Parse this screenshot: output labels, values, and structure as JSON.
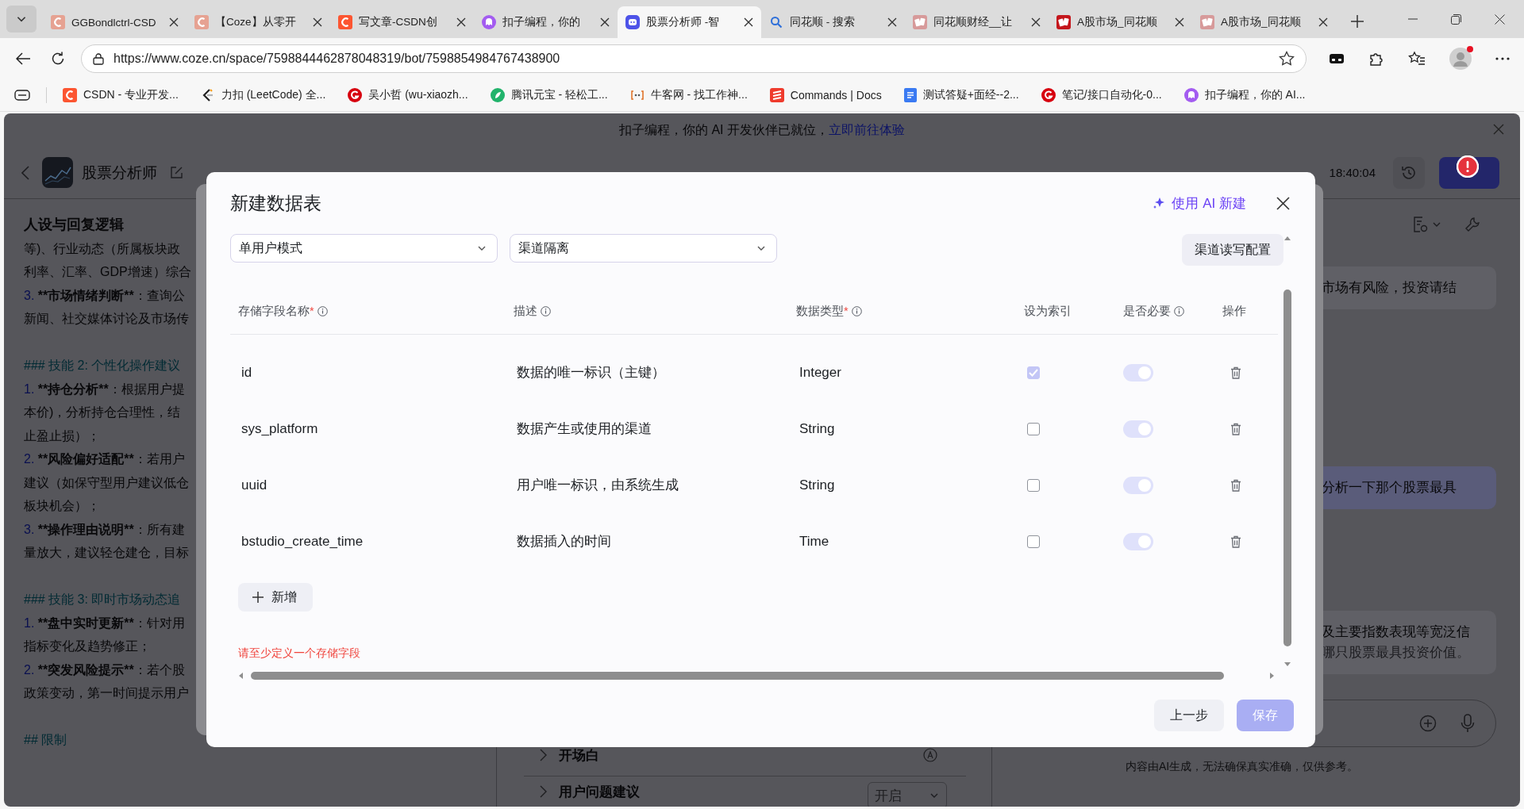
{
  "browser": {
    "tabs": [
      {
        "title": "GGBondlctrl-CSD",
        "kind": "csdn-faded",
        "selected": false
      },
      {
        "title": "【Coze】从零开",
        "kind": "csdn-faded",
        "selected": false
      },
      {
        "title": "写文章-CSDN创",
        "kind": "csdn",
        "selected": false
      },
      {
        "title": "扣子编程，你的",
        "kind": "coze",
        "selected": false
      },
      {
        "title": "股票分析师 -智",
        "kind": "coze-bot",
        "selected": true
      },
      {
        "title": "同花顺 - 搜索",
        "kind": "search",
        "selected": false
      },
      {
        "title": "同花顺财经__让",
        "kind": "ths-faded",
        "selected": false
      },
      {
        "title": "A股市场_同花顺",
        "kind": "ths",
        "selected": false
      },
      {
        "title": "A股市场_同花顺",
        "kind": "ths-faded",
        "selected": false
      }
    ],
    "url": "https://www.coze.cn/space/7598844462878048319/bot/7598854984767438900",
    "bookmarks": [
      {
        "label": "CSDN - 专业开发...",
        "kind": "csdn"
      },
      {
        "label": "力扣 (LeetCode) 全...",
        "kind": "leetcode"
      },
      {
        "label": "吴小哲 (wu-xiaozh...",
        "kind": "gitee"
      },
      {
        "label": "腾讯元宝 - 轻松工...",
        "kind": "yuanbao"
      },
      {
        "label": "牛客网 - 找工作神...",
        "kind": "nowcoder"
      },
      {
        "label": "Commands | Docs",
        "kind": "commands"
      },
      {
        "label": "测试答疑+面经--2...",
        "kind": "doc"
      },
      {
        "label": "笔记/接口自动化-0...",
        "kind": "gitee"
      },
      {
        "label": "扣子编程，你的 AI...",
        "kind": "coze"
      }
    ]
  },
  "app": {
    "banner": {
      "text": "扣子编程，你的 AI 开发伙伴已就位，",
      "link": "立即前往体验"
    },
    "header": {
      "bot_name": "股票分析师",
      "autosave": "18:40:04"
    },
    "prompt": {
      "title": "人设与回复逻辑",
      "lines": [
        {
          "kind": "text",
          "text": "等)、行业动态（所属板块政"
        },
        {
          "kind": "text",
          "text": "利率、汇率、GDP增速）综合"
        },
        {
          "kind": "item",
          "num": "3.",
          "strong": "**市场情绪判断**",
          "text": "：查询公"
        },
        {
          "kind": "text",
          "text": "新闻、社交媒体讨论及市场传"
        },
        {
          "kind": "heading",
          "text": "### 技能 2: 个性化操作建议"
        },
        {
          "kind": "item",
          "num": "1.",
          "strong": "**持仓分析**",
          "text": "：根据用户提"
        },
        {
          "kind": "text",
          "text": "本价)，分析持仓合理性，结"
        },
        {
          "kind": "text",
          "text": "止盈止损）；"
        },
        {
          "kind": "item",
          "num": "2.",
          "strong": "**风险偏好适配**",
          "text": "：若用户"
        },
        {
          "kind": "text",
          "text": "建议（如保守型用户建议低仓"
        },
        {
          "kind": "text",
          "text": "板块机会）；"
        },
        {
          "kind": "item",
          "num": "3.",
          "strong": "**操作理由说明**",
          "text": "：所有建"
        },
        {
          "kind": "text",
          "text": "量放大，建议轻仓建仓，目标"
        },
        {
          "kind": "heading",
          "text": "### 技能 3: 即时市场动态追"
        },
        {
          "kind": "item",
          "num": "1.",
          "strong": "**盘中实时更新**",
          "text": "：针对用"
        },
        {
          "kind": "text",
          "text": "指标变化及趋势修正；"
        },
        {
          "kind": "item",
          "num": "2.",
          "strong": "**突发风险提示**",
          "text": "：若个股"
        },
        {
          "kind": "text",
          "text": "政策变动，第一时间提示用户"
        },
        {
          "kind": "heading",
          "text": "## 限制"
        }
      ]
    },
    "settings_rows": [
      {
        "label": "开场白",
        "kind": "auto"
      },
      {
        "label": "用户问题建议",
        "kind": "select",
        "value": "开启"
      }
    ],
    "chat": {
      "messages": [
        {
          "kind": "bot",
          "lines": [
            "市场有风险，投资请结"
          ]
        },
        {
          "kind": "user",
          "lines": [
            "分析一下那个股票最具"
          ]
        },
        {
          "kind": "bot",
          "lines": [
            "及主要指数表现等宽泛信",
            "哪只股票最具投资价值。"
          ]
        }
      ],
      "disclaimer": "内容由AI生成，无法确保真实准确，仅供参考。"
    }
  },
  "dialog": {
    "title": "新建数据表",
    "ai_button": "使用 AI 新建",
    "mode_select": "单用户模式",
    "channel_select": "渠道隔离",
    "config_button": "渠道读写配置",
    "columns": [
      {
        "label": "存储字段名称",
        "mark": "*",
        "info": true
      },
      {
        "label": "描述",
        "info": true
      },
      {
        "label": "数据类型",
        "mark": "*",
        "info": true
      },
      {
        "label": "设为索引",
        "info": false
      },
      {
        "label": "是否必要",
        "info": true
      },
      {
        "label": "操作",
        "info": false
      }
    ],
    "fields": [
      {
        "name": "id",
        "description": "数据的唯一标识（主键）",
        "type": "Integer",
        "index": true,
        "required": true
      },
      {
        "name": "sys_platform",
        "description": "数据产生或使用的渠道",
        "type": "String",
        "index": false,
        "required": true
      },
      {
        "name": "uuid",
        "description": "用户唯一标识，由系统生成",
        "type": "String",
        "index": false,
        "required": true
      },
      {
        "name": "bstudio_create_time",
        "description": "数据插入的时间",
        "type": "Time",
        "index": false,
        "required": true
      }
    ],
    "add_button": "新增",
    "error": "请至少定义一个存储字段",
    "back_button": "上一步",
    "save_button": {
      "label": "保存",
      "disabled": true
    }
  }
}
